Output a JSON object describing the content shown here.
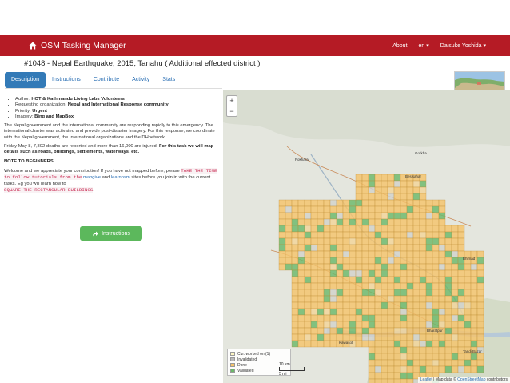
{
  "app": {
    "title": "OSM Tasking Manager"
  },
  "nav": {
    "about": "About",
    "lang": "en ▾",
    "user": "Daisuke Yoshida ▾"
  },
  "project": {
    "title": "#1048 - Nepal Earthquake, 2015, Tanahu ( Additional effected district )"
  },
  "tabs": [
    "Description",
    "Instructions",
    "Contribute",
    "Activity",
    "Stats"
  ],
  "details": {
    "author_label": "Author: ",
    "author": "HOT & Kathmandu Living Labs Volunteers",
    "org_label": "Requesting organization: ",
    "org": "Nepal and International Response community",
    "priority_label": "Priority: ",
    "priority": "Urgent",
    "imagery_label": "Imagery: ",
    "imagery": "Bing and MapBox"
  },
  "body": {
    "p1": "The Nepal government and the international community are responding rapidly to this emergency. The international charter was activated and provide post-disaster imagery. For this response, we coordinate with the Nepal government, the International organizations and the DHnetwork.",
    "p2_a": "Friday May 8, 7,802 deaths are reported and more than 16,000 are injured. ",
    "p2_b": "For this task we will map details such as roads, buildings, settlements, waterways. etc.",
    "p3": "NOTE TO BEGINNERS",
    "p4_a": "Welcome and we appreciate your contribution! If you have not mapped before, please ",
    "p4_code": "TAKE THE TIME to follow tutorials from the",
    "p4_link1": "mapgive",
    "p4_and": " and ",
    "p4_link2": "learnosm",
    "p4_b": " sites before you join in with the current tasks. Eg you will learn how to",
    "p4_code2": "SQUARE THE RECTANGULAR BUILDINGS",
    "p4_end": "."
  },
  "button": {
    "label": "Instructions"
  },
  "map": {
    "zoom_in": "+",
    "zoom_out": "−",
    "legend": [
      {
        "label": "Cur. worked on (1)",
        "color": "#fdf6c3"
      },
      {
        "label": "Invalidated",
        "color": "#b9b9b9"
      },
      {
        "label": "Done",
        "color": "#f5c36b"
      },
      {
        "label": "Validated",
        "color": "#6cb86a"
      }
    ],
    "scale_km": "10 km",
    "scale_mi": "5 mi",
    "attribution_a": "Leaflet",
    "attribution_b": " | Map data © ",
    "attribution_c": "OpenStreetMap",
    "attribution_d": " contributors",
    "places": [
      "Pokhara",
      "Bhimad",
      "Bharatpur",
      "Kawasoti",
      "Tandi Bazar",
      "Besisahar",
      "Gorkha"
    ]
  },
  "colors": {
    "header": "#b51b25",
    "tab_active": "#337ab7",
    "button": "#5cb85c",
    "done": "#f5c36b",
    "validated": "#6cb86a"
  }
}
